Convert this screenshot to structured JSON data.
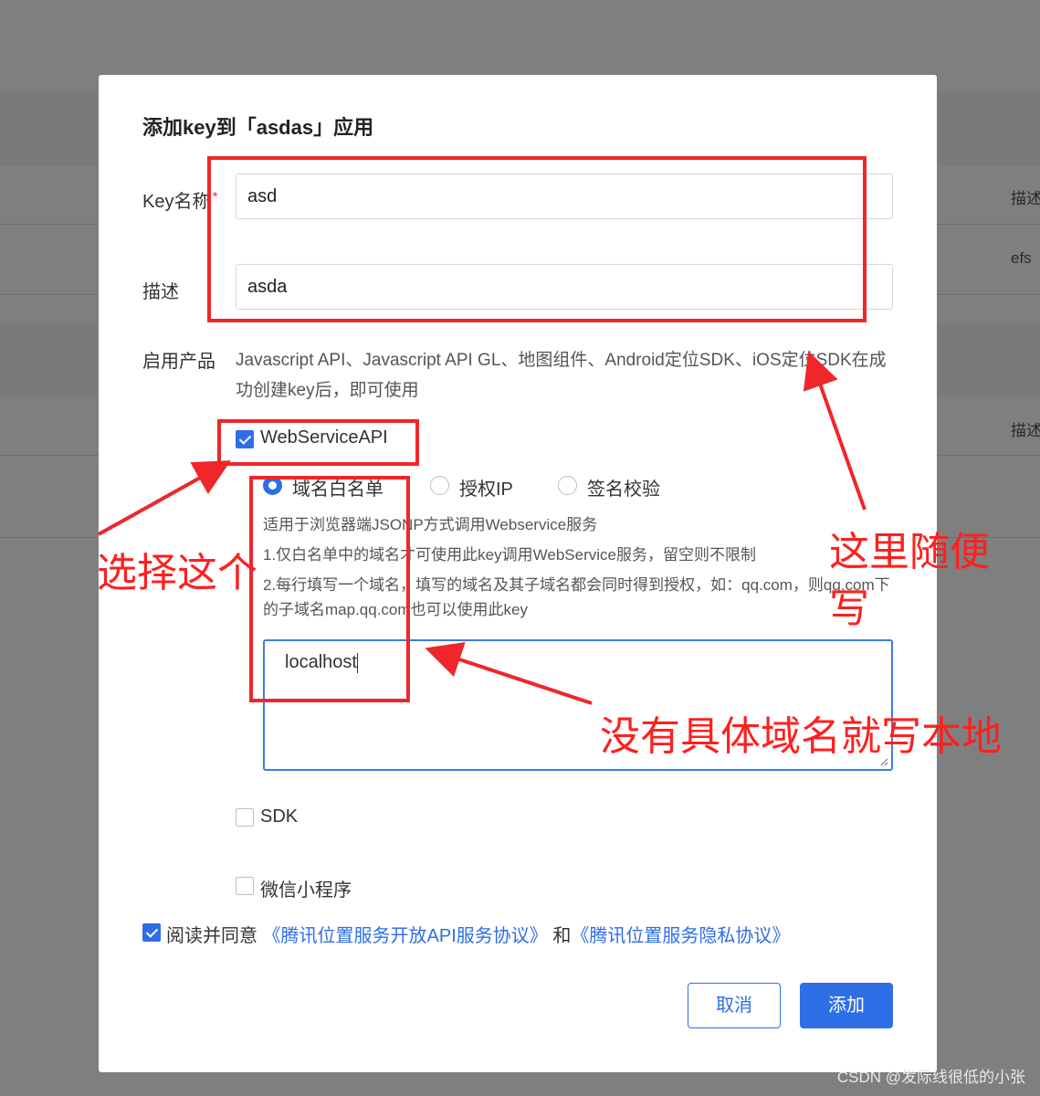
{
  "background": {
    "desc_1": "描述",
    "efs": "efs",
    "desc_2": "描述"
  },
  "dialog": {
    "title": "添加key到「asdas」应用",
    "key_name_label": "Key名称",
    "required_mark": "*",
    "key_name_value": "asd",
    "desc_label": "描述",
    "desc_value": "asda",
    "products_label": "启用产品",
    "products_desc": "Javascript API、Javascript API GL、地图组件、Android定位SDK、iOS定位SDK在成功创建key后，即可使用",
    "webservice": {
      "label": "WebServiceAPI",
      "checked": true,
      "radios": [
        {
          "label": "域名白名单",
          "checked": true
        },
        {
          "label": "授权IP",
          "checked": false
        },
        {
          "label": "签名校验",
          "checked": false
        }
      ],
      "hint_1": "适用于浏览器端JSONP方式调用Webservice服务",
      "hint_2": "1.仅白名单中的域名才可使用此key调用WebService服务，留空则不限制",
      "hint_3": "2.每行填写一个域名，填写的域名及其子域名都会同时得到授权，如：qq.com，则qq.com下的子域名map.qq.com也可以使用此key",
      "whitelist_value": "localhost"
    },
    "sdk_label": "SDK",
    "miniprogram_label": "微信小程序",
    "agree_prefix": "阅读并同意",
    "agree_link_1": "《腾讯位置服务开放API服务协议》",
    "agree_and": "和",
    "agree_link_2": "《腾讯位置服务隐私协议》",
    "cancel_label": "取消",
    "add_label": "添加"
  },
  "annotations": {
    "select_this": "选择这个",
    "anything_here": "这里随便写",
    "localhost_note": "没有具体域名就写本地"
  },
  "watermark": "CSDN @发际线很低的小张",
  "colors": {
    "primary": "#2e6ee6",
    "annotation": "#f0262a"
  }
}
